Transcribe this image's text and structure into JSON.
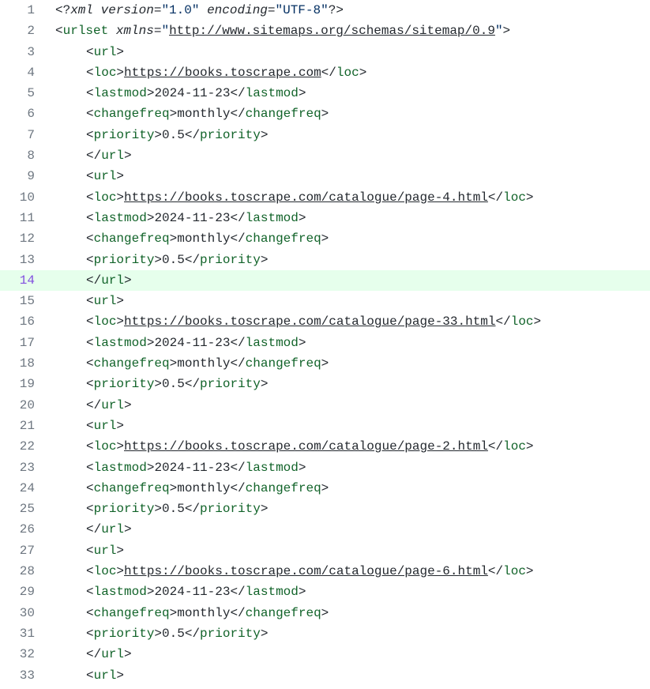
{
  "xml_declaration": {
    "version": "1.0",
    "encoding": "UTF-8"
  },
  "urlset_xmlns": "http://www.sitemaps.org/schemas/sitemap/0.9",
  "highlight_line": 14,
  "urls": [
    {
      "loc": "https://books.toscrape.com",
      "lastmod": "2024-11-23",
      "changefreq": "monthly",
      "priority": "0.5"
    },
    {
      "loc": "https://books.toscrape.com/catalogue/page-4.html",
      "lastmod": "2024-11-23",
      "changefreq": "monthly",
      "priority": "0.5"
    },
    {
      "loc": "https://books.toscrape.com/catalogue/page-33.html",
      "lastmod": "2024-11-23",
      "changefreq": "monthly",
      "priority": "0.5"
    },
    {
      "loc": "https://books.toscrape.com/catalogue/page-2.html",
      "lastmod": "2024-11-23",
      "changefreq": "monthly",
      "priority": "0.5"
    },
    {
      "loc": "https://books.toscrape.com/catalogue/page-6.html",
      "lastmod": "2024-11-23",
      "changefreq": "monthly",
      "priority": "0.5"
    }
  ]
}
